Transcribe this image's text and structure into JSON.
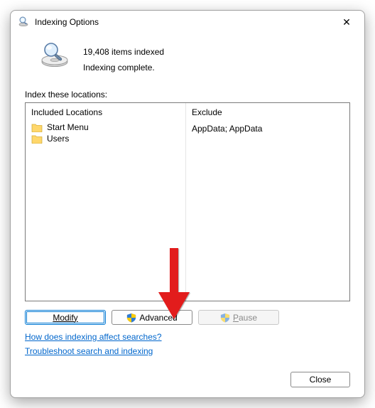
{
  "window": {
    "title": "Indexing Options"
  },
  "status": {
    "count_line": "19,408 items indexed",
    "state_line": "Indexing complete."
  },
  "section_label": "Index these locations:",
  "columns": {
    "included_header": "Included Locations",
    "exclude_header": "Exclude"
  },
  "locations": [
    {
      "name": "Start Menu",
      "exclude": ""
    },
    {
      "name": "Users",
      "exclude": "AppData; AppData"
    }
  ],
  "buttons": {
    "modify": "Modify",
    "advanced": "Advanced",
    "pause": "Pause",
    "close": "Close"
  },
  "links": {
    "how": "How does indexing affect searches?",
    "troubleshoot": "Troubleshoot search and indexing"
  },
  "icons": {
    "title_icon": "magnifier-drive-icon",
    "status_icon": "magnifier-drive-large-icon",
    "folder": "folder-icon",
    "shield": "uac-shield-icon",
    "close": "close-icon"
  }
}
